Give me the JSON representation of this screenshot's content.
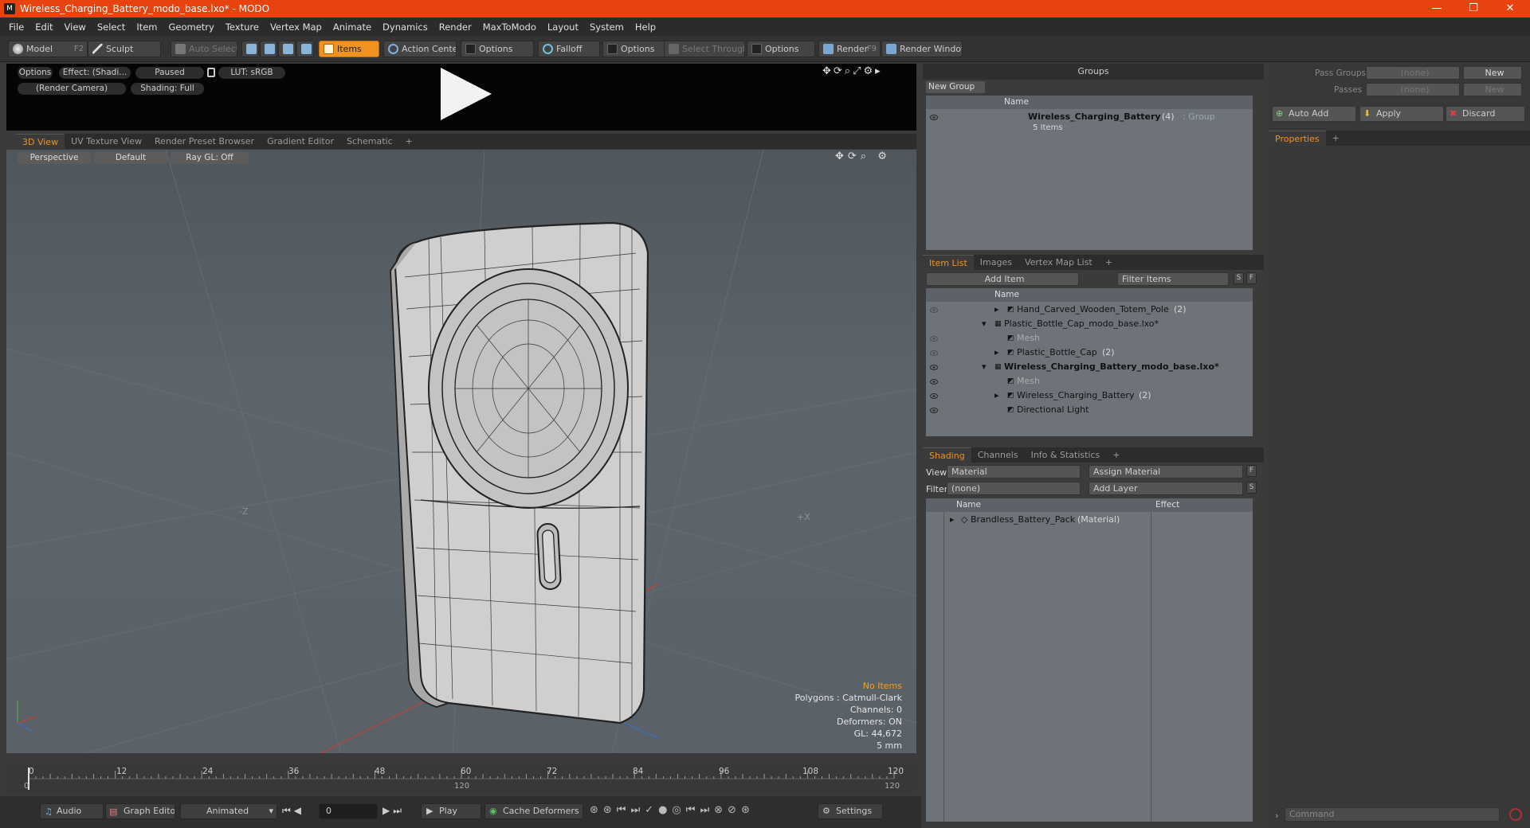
{
  "window": {
    "title": "Wireless_Charging_Battery_modo_base.lxo* - MODO",
    "app_icon": "modo-icon",
    "min": "—",
    "max": "❐",
    "close": "✕"
  },
  "menu": [
    "File",
    "Edit",
    "View",
    "Select",
    "Item",
    "Geometry",
    "Texture",
    "Vertex Map",
    "Animate",
    "Dynamics",
    "Render",
    "MaxToModo",
    "Layout",
    "System",
    "Help"
  ],
  "toolbar": {
    "model": "Model",
    "model_key": "F2",
    "sculpt": "Sculpt",
    "auto_select": "Auto Select",
    "items": "Items",
    "action_center": "Action Center",
    "options": "Options",
    "falloff": "Falloff",
    "select_through": "Select Through",
    "render": "Render",
    "render_key": "F9",
    "render_window": "Render Window"
  },
  "preview": {
    "options": "Options",
    "effect": "Effect: (Shadi...",
    "paused": "Paused",
    "lut": "LUT: sRGB",
    "camera": "(Render Camera)",
    "shading": "Shading: Full"
  },
  "view_tabs": [
    "3D View",
    "UV Texture View",
    "Render Preset Browser",
    "Gradient Editor",
    "Schematic",
    "+"
  ],
  "viewport": {
    "projection": "Perspective",
    "style": "Default",
    "raygl": "Ray GL: Off",
    "axis_z": "-Z",
    "axis_x": "+X"
  },
  "hud": {
    "no_items": "No Items",
    "polygons": "Polygons : Catmull-Clark",
    "channels": "Channels: 0",
    "deformers": "Deformers: ON",
    "gl": "GL: 44,672",
    "scale": "5 mm"
  },
  "timeline": {
    "ticks": [
      "0",
      "12",
      "24",
      "36",
      "48",
      "60",
      "72",
      "84",
      "96",
      "108",
      "120"
    ],
    "start": "0",
    "mid": "120",
    "end": "120"
  },
  "bottom": {
    "audio": "Audio",
    "graph_editor": "Graph Editor",
    "animated": "Animated",
    "frame": "0",
    "play": "Play",
    "cache_deformers": "Cache Deformers",
    "settings": "Settings"
  },
  "groups": {
    "title": "Groups",
    "new_group": "New Group",
    "col_name": "Name",
    "group_name": "Wireless_Charging_Battery",
    "group_count": "(4)",
    "group_type": ": Group",
    "group_items": "5 Items"
  },
  "item_tabs": [
    "Item List",
    "Images",
    "Vertex Map List",
    "+"
  ],
  "item_list": {
    "add_item": "Add Item",
    "filter": "Filter Items",
    "s": "S",
    "f": "F",
    "col_name": "Name",
    "rows": [
      {
        "name": "Hand_Carved_Wooden_Totem_Pole",
        "suffix": "(2)",
        "indent": 2,
        "arrow": "▸",
        "bold": false,
        "muted": false,
        "eye": "dim"
      },
      {
        "name": "Plastic_Bottle_Cap_modo_base.lxo*",
        "suffix": "",
        "indent": 0,
        "arrow": "▾",
        "bold": false,
        "muted": false,
        "eye": "none"
      },
      {
        "name": "Mesh",
        "suffix": "",
        "indent": 2,
        "arrow": "",
        "bold": false,
        "muted": true,
        "eye": "dim"
      },
      {
        "name": "Plastic_Bottle_Cap",
        "suffix": "(2)",
        "indent": 2,
        "arrow": "▸",
        "bold": false,
        "muted": false,
        "eye": "dim"
      },
      {
        "name": "Wireless_Charging_Battery_modo_base.lxo*",
        "suffix": "",
        "indent": 0,
        "arrow": "▾",
        "bold": true,
        "muted": false,
        "eye": "on"
      },
      {
        "name": "Mesh",
        "suffix": "",
        "indent": 2,
        "arrow": "",
        "bold": false,
        "muted": true,
        "eye": "on"
      },
      {
        "name": "Wireless_Charging_Battery",
        "suffix": "(2)",
        "indent": 2,
        "arrow": "▸",
        "bold": false,
        "muted": false,
        "eye": "on"
      },
      {
        "name": "Directional Light",
        "suffix": "",
        "indent": 2,
        "arrow": "",
        "bold": false,
        "muted": false,
        "eye": "on"
      }
    ]
  },
  "shading_tabs": [
    "Shading",
    "Channels",
    "Info & Statistics",
    "+"
  ],
  "shading": {
    "view_label": "View",
    "view_value": "Material",
    "assign": "Assign Material",
    "filter_label": "Filter",
    "filter_value": "(none)",
    "add_layer": "Add Layer",
    "f": "F",
    "s": "S",
    "col_name": "Name",
    "col_effect": "Effect",
    "mat_name": "Brandless_Battery_Pack",
    "mat_type": "(Material)"
  },
  "right": {
    "pass_groups": "Pass Groups",
    "passes": "Passes",
    "none": "(none)",
    "new": "New",
    "auto_add": "Auto Add",
    "apply": "Apply",
    "discard": "Discard",
    "properties": "Properties",
    "plus": "+",
    "command": "Command"
  }
}
